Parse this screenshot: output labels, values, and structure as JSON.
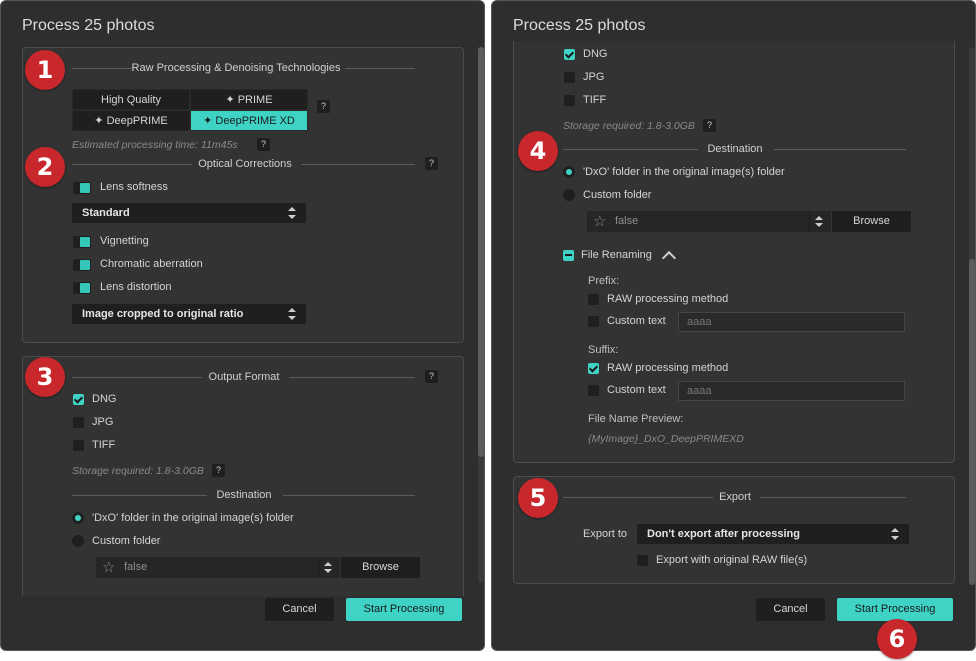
{
  "colors": {
    "accent": "#3fd3c6",
    "badge": "#c8282b",
    "dialog_bg": "#2e2e2e"
  },
  "dialog_left": {
    "title": "Process 25 photos",
    "raw_section": {
      "title": "Raw Processing & Denoising Technologies",
      "options": [
        "High Quality",
        "PRIME",
        "DeepPRIME",
        "DeepPRIME XD"
      ],
      "active": "DeepPRIME XD",
      "help": "?",
      "estimate": "Estimated processing time: 11m45s"
    },
    "optical_section": {
      "title": "Optical Corrections",
      "help": "?",
      "lens_softness": "Lens softness",
      "softness_mode": "Standard",
      "vignetting": "Vignetting",
      "chromatic": "Chromatic aberration",
      "distortion": "Lens distortion",
      "crop_mode": "Image cropped to original ratio"
    },
    "output_section": {
      "title": "Output Format",
      "help": "?",
      "formats": [
        {
          "label": "DNG",
          "checked": true
        },
        {
          "label": "JPG",
          "checked": false
        },
        {
          "label": "TIFF",
          "checked": false
        }
      ],
      "storage": "Storage required: 1.8-3.0GB",
      "destination_title": "Destination",
      "dest_dxo": "'DxO' folder in the original image(s) folder",
      "dest_custom": "Custom folder",
      "folder_value": "false",
      "browse": "Browse"
    },
    "cancel": "Cancel",
    "start": "Start Processing"
  },
  "dialog_right": {
    "title": "Process 25 photos",
    "formats": [
      {
        "label": "DNG",
        "checked": true
      },
      {
        "label": "JPG",
        "checked": false
      },
      {
        "label": "TIFF",
        "checked": false
      }
    ],
    "storage": "Storage required: 1.8-3.0GB",
    "destination_title": "Destination",
    "dest_dxo": "'DxO' folder in the original image(s) folder",
    "dest_custom": "Custom folder",
    "folder_value": "false",
    "browse": "Browse",
    "file_renaming": "File Renaming",
    "prefix_label": "Prefix:",
    "prefix_raw": "RAW processing method",
    "prefix_custom": "Custom text",
    "prefix_custom_value": "aaaa",
    "suffix_label": "Suffix:",
    "suffix_raw": "RAW processing method",
    "suffix_custom": "Custom text",
    "suffix_custom_value": "aaaa",
    "preview_label": "File Name Preview:",
    "preview_value": "{MyImage}_DxO_DeepPRIMEXD",
    "export_title": "Export",
    "export_to_label": "Export to",
    "export_to_value": "Don't export after processing",
    "export_raw": "Export with original RAW file(s)",
    "cancel": "Cancel",
    "start": "Start Processing"
  },
  "badges": [
    "1",
    "2",
    "3",
    "4",
    "5",
    "6"
  ]
}
